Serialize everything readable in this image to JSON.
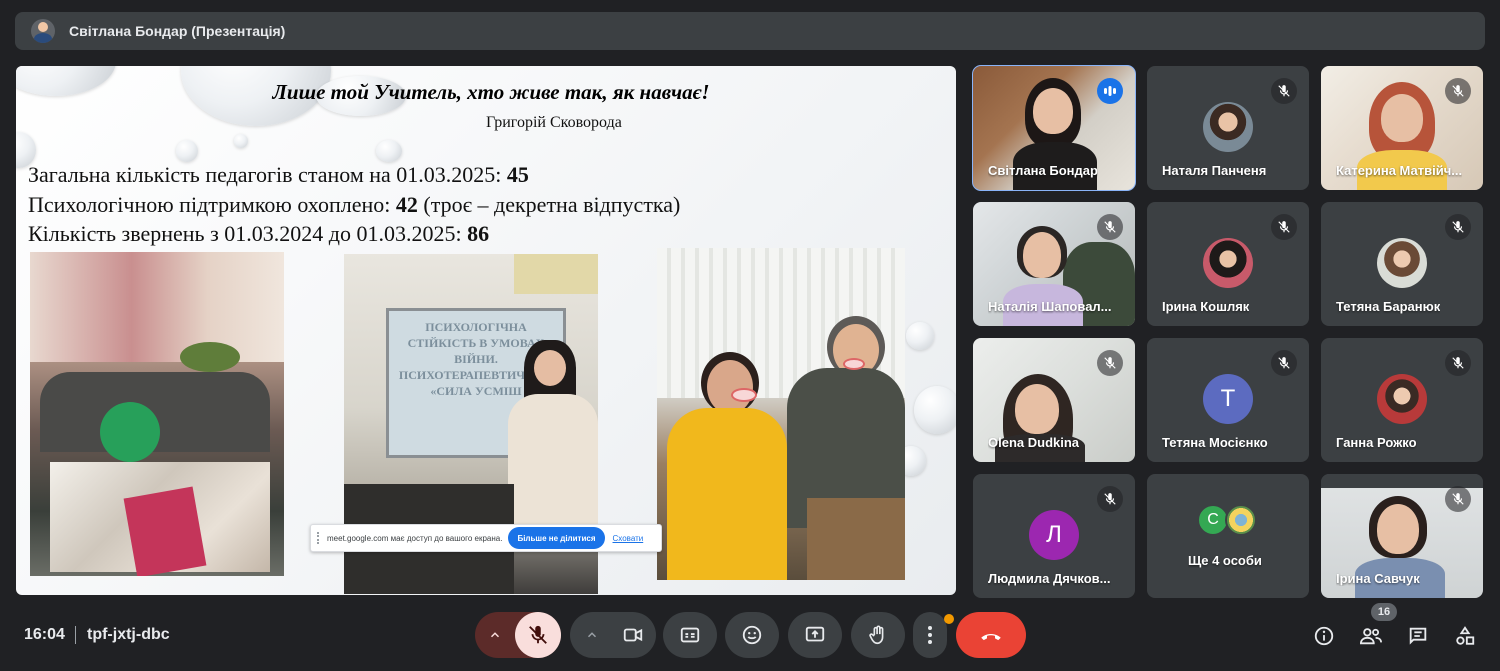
{
  "presenter": {
    "name": "Світлана Бондар (Презентація)"
  },
  "slide": {
    "title": "Лише той Учитель, хто живе так, як навчає!",
    "author": "Григорій Сковорода",
    "stats": [
      {
        "label": "Загальна кількість педагогів станом на 01.03.2025: ",
        "value": "45",
        "note": ""
      },
      {
        "label": "Психологічною підтримкою охоплено: ",
        "value": "42",
        "note": " (троє – декретна відпустка)"
      },
      {
        "label": "Кількість звернень з 01.03.2024 до 01.03.2025: ",
        "value": "86",
        "note": ""
      }
    ],
    "board_text": "ПСИХОЛОГІЧНА СТІЙКІСТЬ В УМОВАХ ВІЙНИ. ПСИХОТЕРАПЕВТИЧНИЙ «СИЛА УСМІШ"
  },
  "share_banner": {
    "text": "meet.google.com має доступ до вашого екрана.",
    "stop_label": "Більше не ділитися",
    "hide_label": "Сховати"
  },
  "participants": [
    {
      "name": "Світлана Бондар",
      "kind": "video",
      "speaking": true
    },
    {
      "name": "Наталя Панченя",
      "kind": "avatar",
      "muted": true
    },
    {
      "name": "Катерина Матвійч...",
      "kind": "video",
      "muted": true
    },
    {
      "name": "Наталія Шаповал...",
      "kind": "video",
      "muted": true
    },
    {
      "name": "Ірина Кошляк",
      "kind": "avatar",
      "muted": true
    },
    {
      "name": "Тетяна Баранюк",
      "kind": "avatar",
      "muted": true
    },
    {
      "name": "Olena Dudkina",
      "kind": "video",
      "muted": true
    },
    {
      "name": "Тетяна Мосієнко",
      "kind": "letter",
      "letter": "T",
      "color": "#5c6bc0",
      "muted": true
    },
    {
      "name": "Ганна Рожко",
      "kind": "avatar",
      "muted": true
    },
    {
      "name": "Людмила Дячков...",
      "kind": "letter",
      "letter": "Л",
      "color": "#9c27b0",
      "muted": true
    },
    {
      "name": "Ще 4 особи",
      "kind": "more",
      "letter": "С",
      "color": "#34a853"
    },
    {
      "name": "Ірина Савчук",
      "kind": "video",
      "muted": true
    }
  ],
  "bottom_bar": {
    "time": "16:04",
    "meeting_code": "tpf-jxtj-dbc",
    "participant_count": "16"
  },
  "colors": {
    "accent": "#8ab4f8",
    "hangup": "#ea4335",
    "button": "#3c4043",
    "mic_off_bg": "#f9dedc"
  }
}
